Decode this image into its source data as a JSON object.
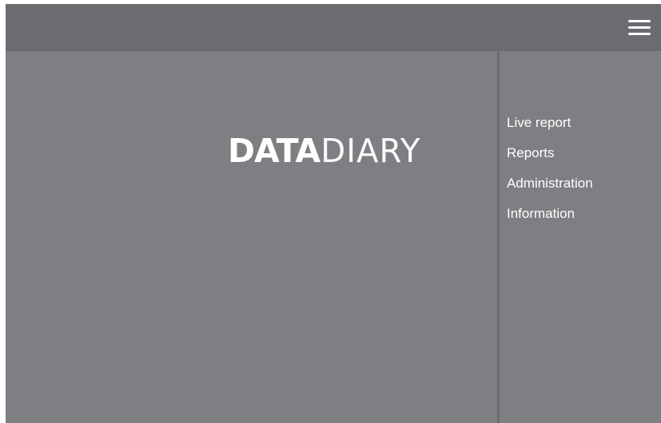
{
  "header": {
    "menu_icon": "hamburger-menu-icon"
  },
  "logo": {
    "bold": "DATA",
    "thin": "DIARY"
  },
  "sidebar": {
    "items": [
      {
        "label": "Live report"
      },
      {
        "label": "Reports"
      },
      {
        "label": "Administration"
      },
      {
        "label": "Information"
      }
    ]
  },
  "colors": {
    "background": "#7e7f82",
    "topbar": "#6b6c6f",
    "text": "#ffffff"
  }
}
